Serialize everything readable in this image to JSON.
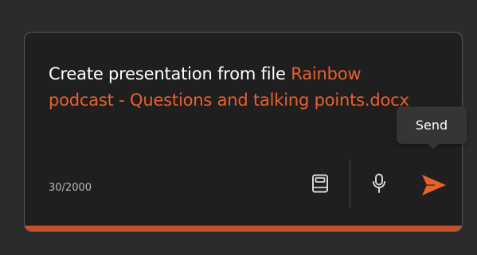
{
  "prompt": {
    "text": "Create presentation from file ",
    "file_name": "Rainbow podcast - Questions and talking points.docx"
  },
  "char_count": "30/2000",
  "icons": {
    "notebook": "notebook-icon",
    "microphone": "microphone-icon",
    "send": "send-icon"
  },
  "tooltip": {
    "label": "Send"
  },
  "colors": {
    "accent": "#e8612c",
    "accent_bar": "#c8502a",
    "background": "#2b2b2b",
    "box": "#1f1f1f",
    "tooltip": "#353535"
  }
}
